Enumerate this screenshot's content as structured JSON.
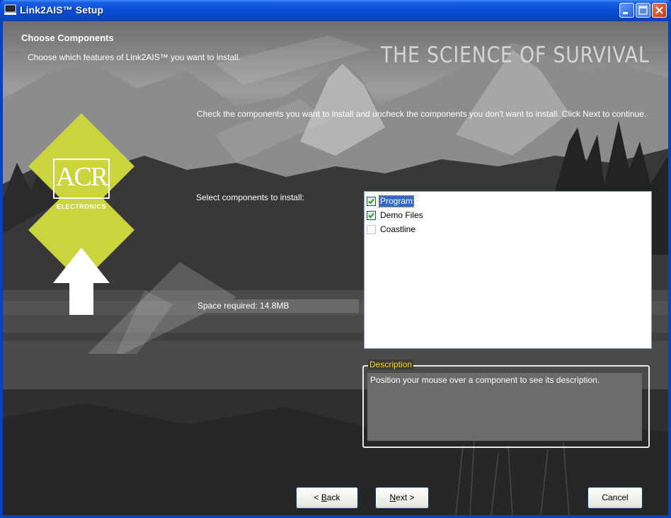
{
  "window": {
    "title": "Link2AIS™ Setup"
  },
  "header": {
    "title": "Choose Components",
    "subtitle": "Choose which features of Link2AIS™ you want to install.",
    "slogan": "THE SCIENCE OF SURVIVAL"
  },
  "logo": {
    "brand": "ACR",
    "tagline": "ELECTRONICS",
    "color": "#cbd33f"
  },
  "main": {
    "instructions": "Check the components you want to install and uncheck the components you don't want to install. Click Next to continue.",
    "select_label": "Select components to install:",
    "space_required": "Space required: 14.8MB",
    "components": [
      {
        "label": "Program",
        "checked": true,
        "selected": true
      },
      {
        "label": "Demo Files",
        "checked": true,
        "selected": false
      },
      {
        "label": "Coastline",
        "checked": false,
        "selected": false
      }
    ],
    "description": {
      "legend": "Description",
      "text": "Position your mouse over a component to see its description."
    }
  },
  "buttons": {
    "back": {
      "prefix": "< ",
      "mnemonic": "B",
      "rest": "ack"
    },
    "next": {
      "mnemonic": "N",
      "rest": "ext >"
    },
    "cancel": "Cancel"
  }
}
